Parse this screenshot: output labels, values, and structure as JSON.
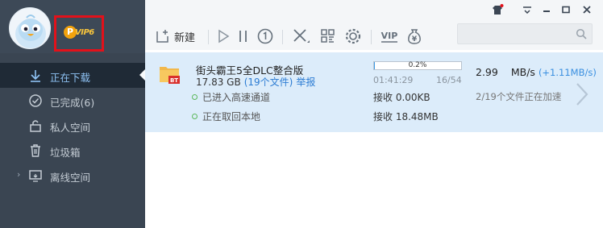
{
  "sidebar": {
    "vip_level": "VIP6",
    "vip_coin": "P",
    "nav": [
      {
        "label": "正在下载",
        "icon": "download-icon",
        "active": true
      },
      {
        "label": "已完成(6)",
        "icon": "check-circle-icon",
        "active": false
      },
      {
        "label": "私人空间",
        "icon": "lock-icon",
        "active": false
      },
      {
        "label": "垃圾箱",
        "icon": "trash-icon",
        "active": false
      },
      {
        "label": "离线空间",
        "icon": "cloud-screen-icon",
        "active": false
      }
    ]
  },
  "toolbar": {
    "new_label": "新建",
    "search_placeholder": "",
    "vip_icon_text": "VIP",
    "money_icon_text": "¥"
  },
  "download": {
    "file_name": "街头霸王5全DLC整合版",
    "file_badge": "BT",
    "size": "17.83 GB",
    "file_count": "(19个文件)",
    "report": "举报",
    "progress_text": "0.2%",
    "progress_value": 0.2,
    "elapsed": "01:41:29",
    "pieces": "16/54",
    "speed_value": "2.99",
    "speed_unit": "MB/s",
    "speed_boost": "(+1.11MB/s)",
    "channel1": "已进入高速通道",
    "recv1": "接收 0.00KB",
    "accel_status": "2/19个文件正在加速",
    "channel2": "正在取回本地",
    "recv2": "接收 18.48MB"
  },
  "colors": {
    "sidebar_bg": "#3a4552",
    "active_bg": "#1f2a36",
    "row_bg": "#dcecfa",
    "accent": "#2c7cd3",
    "vip_red": "#e3111a"
  }
}
